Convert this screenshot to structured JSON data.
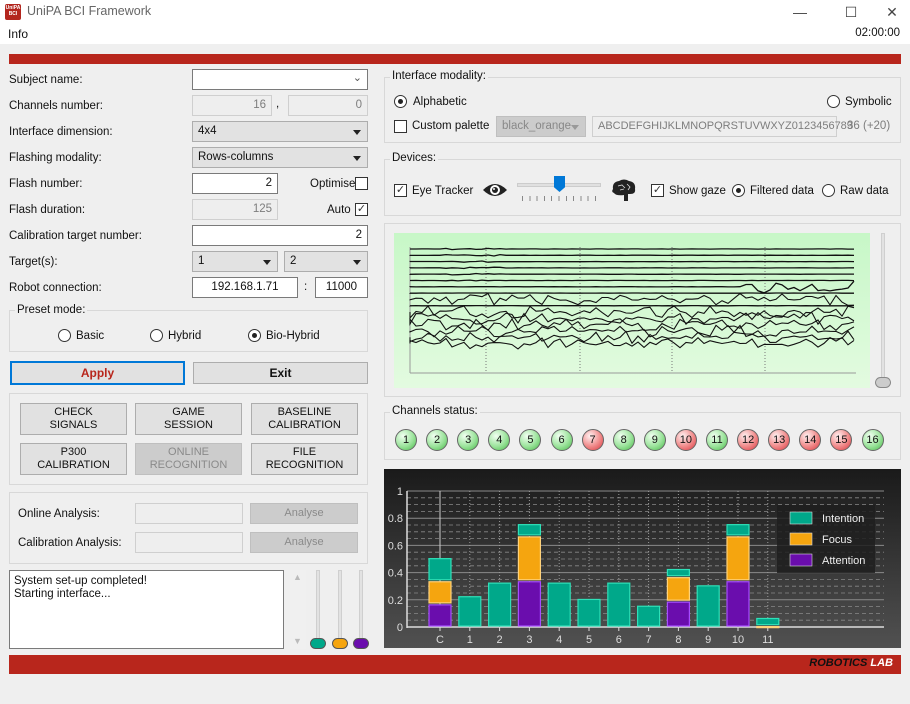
{
  "window": {
    "title": "UniPA BCI Framework",
    "icon_text": "UniPA BCI",
    "minimize_glyph": "—",
    "maximize_glyph": "☐",
    "close_glyph": "✕"
  },
  "menubar": {
    "items": [
      "Info"
    ],
    "clock": "02:00:00"
  },
  "form": {
    "subject_name": {
      "label": "Subject name:",
      "value": ""
    },
    "channels_number": {
      "label": "Channels number:",
      "value1": "16",
      "separator": ",",
      "value2": "0"
    },
    "interface_dimension": {
      "label": "Interface dimension:",
      "value": "4x4"
    },
    "flashing_modality": {
      "label": "Flashing modality:",
      "value": "Rows-columns"
    },
    "flash_number": {
      "label": "Flash number:",
      "value": "2",
      "optimise_label": "Optimise",
      "optimise_checked": false
    },
    "flash_duration": {
      "label": "Flash duration:",
      "value": "125",
      "auto_label": "Auto",
      "auto_checked": true
    },
    "calibration_target_number": {
      "label": "Calibration target number:",
      "value": "2"
    },
    "targets": {
      "label": "Target(s):",
      "value1": "1",
      "value2": "2"
    },
    "robot_connection": {
      "label": "Robot connection:",
      "ip": "192.168.1.71",
      "separator": ":",
      "port": "11000"
    }
  },
  "preset_mode": {
    "title": "Preset mode:",
    "options": [
      "Basic",
      "Hybrid",
      "Bio-Hybrid"
    ],
    "selected": "Bio-Hybrid"
  },
  "actions": {
    "apply": "Apply",
    "exit": "Exit"
  },
  "session_buttons": [
    {
      "line1": "CHECK",
      "line2": "SIGNALS",
      "enabled": true
    },
    {
      "line1": "GAME",
      "line2": "SESSION",
      "enabled": true
    },
    {
      "line1": "BASELINE",
      "line2": "CALIBRATION",
      "enabled": true
    },
    {
      "line1": "P300",
      "line2": "CALIBRATION",
      "enabled": true
    },
    {
      "line1": "ONLINE",
      "line2": "RECOGNITION",
      "enabled": false
    },
    {
      "line1": "FILE",
      "line2": "RECOGNITION",
      "enabled": true
    }
  ],
  "analysis": {
    "online": {
      "label": "Online Analysis:",
      "value": "",
      "button": "Analyse"
    },
    "calibration": {
      "label": "Calibration Analysis:",
      "value": "",
      "button": "Analyse"
    }
  },
  "log": {
    "lines": [
      "System set-up completed!",
      "Starting interface..."
    ]
  },
  "level_sliders": [
    {
      "name": "intention",
      "color": "#00a88a",
      "value": 0
    },
    {
      "name": "focus",
      "color": "#f5a50f",
      "value": 0
    },
    {
      "name": "attention",
      "color": "#6a0dad",
      "value": 0
    }
  ],
  "interface_modality": {
    "title": "Interface modality:",
    "options": [
      "Alphabetic",
      "Symbolic"
    ],
    "selected": "Alphabetic",
    "custom_palette_label": "Custom palette",
    "custom_palette_checked": false,
    "palette_value": "black_orange",
    "charset": "ABCDEFGHIJKLMNOPQRSTUVWXYZ0123456789",
    "charset_count": "36 (+20)"
  },
  "devices": {
    "title": "Devices:",
    "eye_tracker_label": "Eye Tracker",
    "eye_tracker_checked": true,
    "blend_slider_value": 0.5,
    "show_gaze_label": "Show gaze",
    "show_gaze_checked": true,
    "data_options": [
      "Filtered data",
      "Raw data"
    ],
    "data_selected": "Filtered data"
  },
  "channels_status": {
    "title": "Channels status:",
    "channels": [
      {
        "n": "1",
        "ok": true
      },
      {
        "n": "2",
        "ok": true
      },
      {
        "n": "3",
        "ok": true
      },
      {
        "n": "4",
        "ok": true
      },
      {
        "n": "5",
        "ok": true
      },
      {
        "n": "6",
        "ok": true
      },
      {
        "n": "7",
        "ok": false
      },
      {
        "n": "8",
        "ok": true
      },
      {
        "n": "9",
        "ok": true
      },
      {
        "n": "10",
        "ok": false
      },
      {
        "n": "11",
        "ok": true
      },
      {
        "n": "12",
        "ok": false
      },
      {
        "n": "13",
        "ok": false
      },
      {
        "n": "14",
        "ok": false
      },
      {
        "n": "15",
        "ok": false
      },
      {
        "n": "16",
        "ok": true
      }
    ]
  },
  "colors": {
    "brand_red": "#b8261c",
    "intention": "#00a88a",
    "focus": "#f5a50f",
    "attention": "#6a0dad"
  },
  "footer": {
    "brand_part1": "ROBOTICS",
    "brand_part2": "LAB"
  },
  "chart_data": {
    "type": "bar",
    "stacked": true,
    "categories": [
      "C",
      "1",
      "2",
      "3",
      "4",
      "5",
      "6",
      "7",
      "8",
      "9",
      "10",
      "11"
    ],
    "series": [
      {
        "name": "Attention",
        "color": "#6a0dad",
        "values": [
          0.17,
          0,
          0,
          0.34,
          0,
          0,
          0,
          0,
          0.19,
          0,
          0.34,
          0
        ]
      },
      {
        "name": "Focus",
        "color": "#f5a50f",
        "values": [
          0.17,
          0,
          0,
          0.33,
          0,
          0,
          0,
          0,
          0.18,
          0,
          0.33,
          0.01
        ]
      },
      {
        "name": "Intention",
        "color": "#00a88a",
        "values": [
          0.17,
          0.23,
          0.33,
          0.09,
          0.33,
          0.21,
          0.33,
          0.16,
          0.06,
          0.31,
          0.09,
          0.06
        ]
      }
    ],
    "legend": [
      "Intention",
      "Focus",
      "Attention"
    ],
    "legend_position": "top-right",
    "yticks": [
      "0",
      "0.2",
      "0.4",
      "0.6",
      "0.8",
      "1"
    ],
    "ylim": [
      0,
      1
    ],
    "grid": true,
    "title": "",
    "xlabel": "",
    "ylabel": ""
  }
}
